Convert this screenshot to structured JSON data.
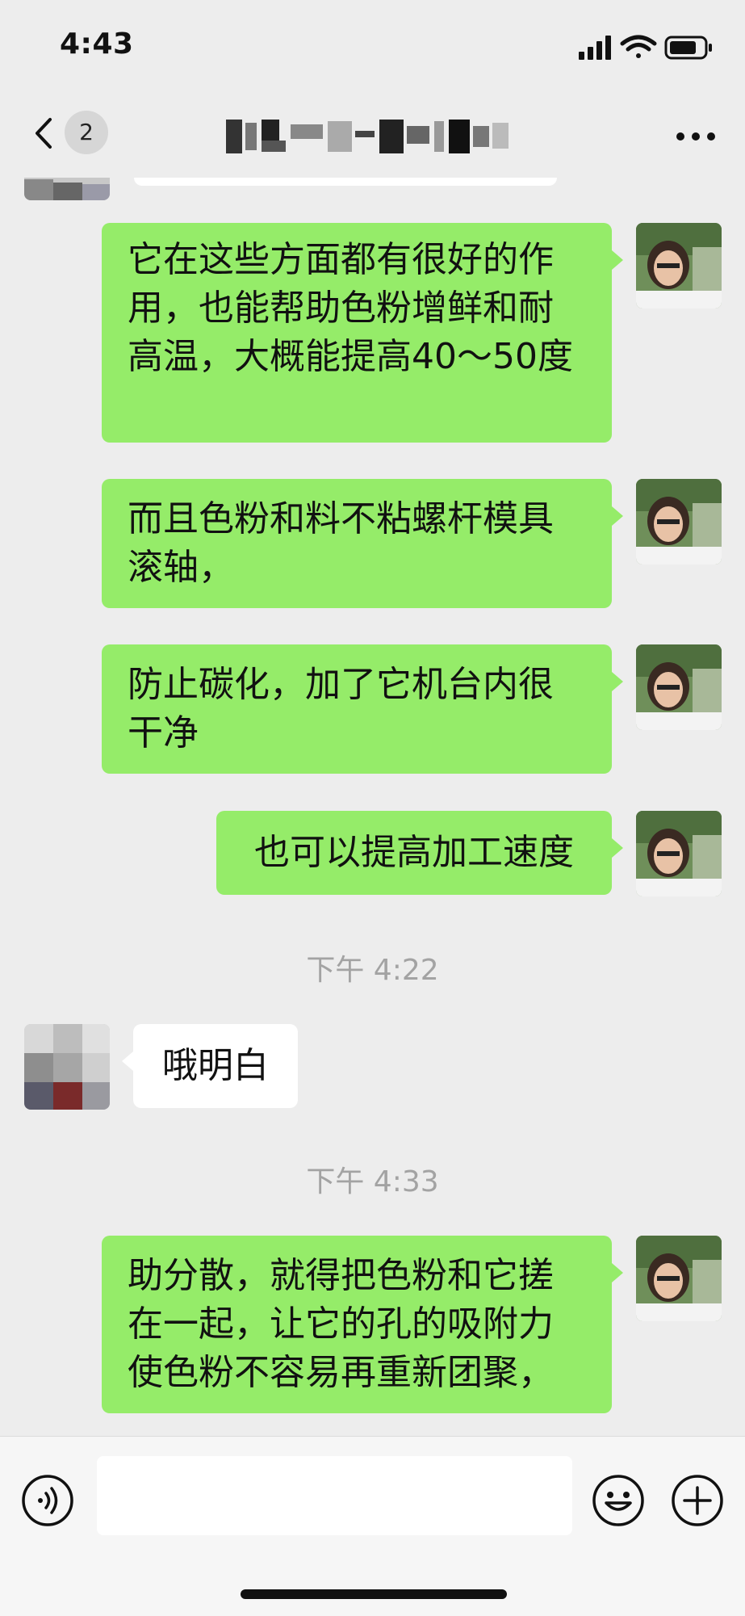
{
  "status": {
    "time": "4:43"
  },
  "nav": {
    "unread_count": "2"
  },
  "messages": [
    {
      "text": "它在这些方面都有很好的作用，也能帮助色粉增鲜和耐高温，大概能提高40～50度"
    },
    {
      "text": "而且色粉和料不粘螺杆模具滚轴，"
    },
    {
      "text": "防止碳化，加了它机台内很干净"
    },
    {
      "text": "也可以提高加工速度"
    },
    {
      "text": "哦明白"
    },
    {
      "text": "助分散，就得把色粉和它搓在一起，让它的孔的吸附力使色粉不容易再重新团聚，"
    }
  ],
  "timestamps": [
    "下午 4:22",
    "下午 4:33"
  ],
  "colors": {
    "outgoing_bubble": "#95ec69",
    "incoming_bubble": "#ffffff",
    "background": "#ededed"
  }
}
